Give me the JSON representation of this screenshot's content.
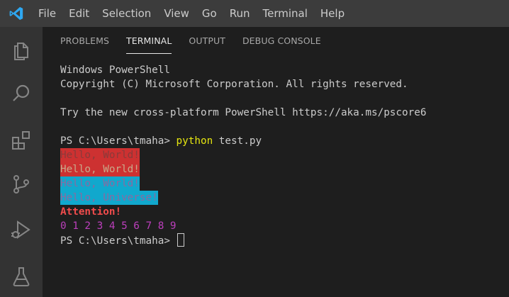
{
  "menu": {
    "logo_icon": "vscode-logo-icon",
    "items": [
      "File",
      "Edit",
      "Selection",
      "View",
      "Go",
      "Run",
      "Terminal",
      "Help"
    ]
  },
  "activitybar": {
    "icons": [
      "explorer-icon",
      "search-icon",
      "extensions-icon",
      "source-control-icon",
      "run-debug-icon",
      "testing-icon"
    ]
  },
  "panel": {
    "tabs": [
      {
        "label": "PROBLEMS",
        "active": false
      },
      {
        "label": "TERMINAL",
        "active": true
      },
      {
        "label": "OUTPUT",
        "active": false
      },
      {
        "label": "DEBUG CONSOLE",
        "active": false
      }
    ]
  },
  "terminal": {
    "line1": "Windows PowerShell",
    "line2": "Copyright (C) Microsoft Corporation. All rights reserved.",
    "line3": "",
    "line4": "Try the new cross-platform PowerShell https://aka.ms/pscore6",
    "line5": "",
    "prompt": "PS C:\\Users\\tmaha> ",
    "command_program": "python",
    "command_args": " test.py",
    "out1": "Hello, World!",
    "out2": "Hello, World!",
    "out3": "Hello, World!",
    "out4": "Hello, Universe!",
    "out5": "Attention!",
    "out6": "0 1 2 3 4 5 6 7 8 9",
    "prompt2": "PS C:\\Users\\tmaha> "
  },
  "colors": {
    "accent_blue": "#0098ff",
    "red_bg": "#cd3131",
    "cyan_bg": "#11a8cd",
    "yellow": "#e5e510",
    "magenta": "#bc3fbc"
  }
}
